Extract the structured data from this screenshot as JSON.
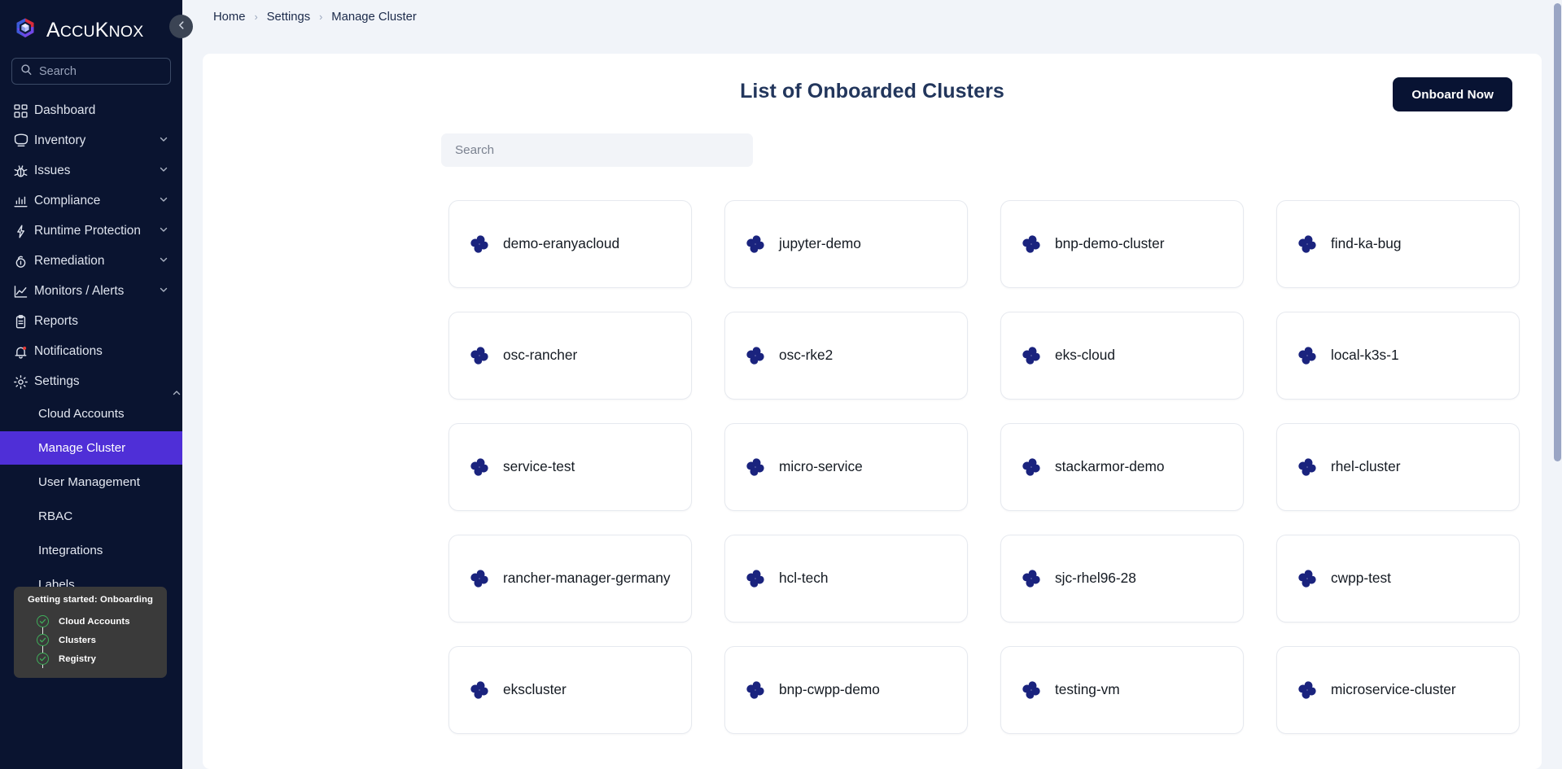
{
  "brand": {
    "logo_icon": "accuknox-cube-logo",
    "name_accu": "A",
    "name_full": "AccuKnox",
    "logo_colors": {
      "red": "#d92b3a",
      "blue": "#3b5bdb",
      "violet": "#7048e8"
    }
  },
  "sidebar": {
    "search": {
      "placeholder": "Search",
      "value": "",
      "icon": "search-icon"
    },
    "collapse_icon": "chevron-left-icon",
    "items": [
      {
        "label": "Dashboard",
        "icon": "dashboard-grid-icon",
        "expandable": false
      },
      {
        "label": "Inventory",
        "icon": "inventory-monitor-icon",
        "expandable": true
      },
      {
        "label": "Issues",
        "icon": "bug-icon",
        "expandable": true
      },
      {
        "label": "Compliance",
        "icon": "compliance-bars-icon",
        "expandable": true
      },
      {
        "label": "Runtime Protection",
        "icon": "lightning-bolt-icon",
        "expandable": true
      },
      {
        "label": "Remediation",
        "icon": "lock-shield-icon",
        "expandable": true
      },
      {
        "label": "Monitors / Alerts",
        "icon": "line-chart-icon",
        "expandable": true
      },
      {
        "label": "Reports",
        "icon": "clipboard-icon",
        "expandable": false
      },
      {
        "label": "Notifications",
        "icon": "bell-icon",
        "expandable": false
      },
      {
        "label": "Settings",
        "icon": "gear-icon",
        "expandable": true,
        "expanded": true
      }
    ],
    "settings_children": [
      {
        "label": "Cloud Accounts",
        "active": false
      },
      {
        "label": "Manage Cluster",
        "active": true
      },
      {
        "label": "User Management",
        "active": false
      },
      {
        "label": "RBAC",
        "active": false
      },
      {
        "label": "Integrations",
        "active": false
      },
      {
        "label": "Labels",
        "active": false
      }
    ],
    "active_accent": "#4f2fd7",
    "background": "#0a1430"
  },
  "getting_started": {
    "title": "Getting started: Onboarding",
    "steps": [
      {
        "label": "Cloud Accounts",
        "icon": "check-circle-icon",
        "done": true
      },
      {
        "label": "Clusters",
        "icon": "check-circle-icon",
        "done": true
      },
      {
        "label": "Registry",
        "icon": "check-circle-icon",
        "done": true
      }
    ],
    "check_color": "#3fae5a"
  },
  "breadcrumb": {
    "items": [
      {
        "label": "Home",
        "current": false
      },
      {
        "label": "Settings",
        "current": false
      },
      {
        "label": "Manage Cluster",
        "current": true
      }
    ],
    "separator": "›"
  },
  "main": {
    "title": "List of Onboarded Clusters",
    "onboard_button": {
      "label": "Onboard Now",
      "color": "#081333"
    },
    "search": {
      "placeholder": "Search",
      "value": ""
    }
  },
  "clusters": [
    {
      "name": "demo-eranyacloud",
      "icon": "cluster-pinwheel-icon"
    },
    {
      "name": "jupyter-demo",
      "icon": "cluster-pinwheel-icon"
    },
    {
      "name": "bnp-demo-cluster",
      "icon": "cluster-pinwheel-icon"
    },
    {
      "name": "find-ka-bug",
      "icon": "cluster-pinwheel-icon"
    },
    {
      "name": "osc-rancher",
      "icon": "cluster-pinwheel-icon"
    },
    {
      "name": "osc-rke2",
      "icon": "cluster-pinwheel-icon"
    },
    {
      "name": "eks-cloud",
      "icon": "cluster-pinwheel-icon"
    },
    {
      "name": "local-k3s-1",
      "icon": "cluster-pinwheel-icon"
    },
    {
      "name": "service-test",
      "icon": "cluster-pinwheel-icon"
    },
    {
      "name": "micro-service",
      "icon": "cluster-pinwheel-icon"
    },
    {
      "name": "stackarmor-demo",
      "icon": "cluster-pinwheel-icon"
    },
    {
      "name": "rhel-cluster",
      "icon": "cluster-pinwheel-icon"
    },
    {
      "name": "rancher-manager-germany",
      "icon": "cluster-pinwheel-icon"
    },
    {
      "name": "hcl-tech",
      "icon": "cluster-pinwheel-icon"
    },
    {
      "name": "sjc-rhel96-28",
      "icon": "cluster-pinwheel-icon"
    },
    {
      "name": "cwpp-test",
      "icon": "cluster-pinwheel-icon"
    },
    {
      "name": "ekscluster",
      "icon": "cluster-pinwheel-icon"
    },
    {
      "name": "bnp-cwpp-demo",
      "icon": "cluster-pinwheel-icon"
    },
    {
      "name": "testing-vm",
      "icon": "cluster-pinwheel-icon"
    },
    {
      "name": "microservice-cluster",
      "icon": "cluster-pinwheel-icon"
    }
  ],
  "cluster_icon_color": "#1a237e",
  "scrollbar": {
    "thumb_color": "#9aa5c4",
    "track_color": "#f1f4f9"
  }
}
